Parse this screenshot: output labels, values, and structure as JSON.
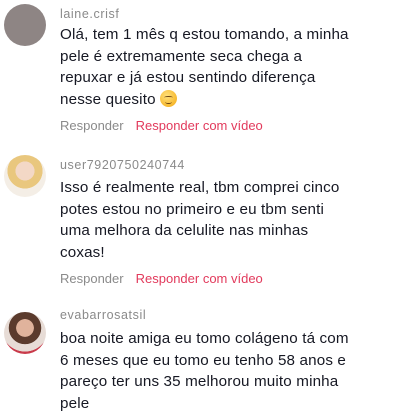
{
  "comments": [
    {
      "username": "laine.crisf",
      "lines": [
        "Olá, tem 1 mês q estou tomando, a minha",
        "pele é extremamente seca chega a",
        "repuxar e já estou sentindo diferença",
        "nesse quesito"
      ],
      "emoji_icon": "relieved-face-emoji",
      "reply_label": "Responder",
      "reply_video_label": "Responder com vídeo"
    },
    {
      "username": "user7920750240744",
      "lines": [
        "Isso é realmente real, tbm comprei cinco",
        "potes estou no primeiro e eu tbm senti",
        "uma melhora da celulite nas minhas",
        "coxas!"
      ],
      "reply_label": "Responder",
      "reply_video_label": "Responder com vídeo"
    },
    {
      "username": "evabarrosatsil",
      "lines": [
        "boa noite amiga eu tomo colágeno tá com",
        "6 meses que eu tomo eu tenho 58 anos e",
        "pareço ter uns 35 melhorou muito minha",
        "pele"
      ]
    }
  ],
  "colors": {
    "username": "#8a8a8a",
    "text": "#161823",
    "reply": "#8a8a8a",
    "reply_video": "#e23a5c"
  }
}
